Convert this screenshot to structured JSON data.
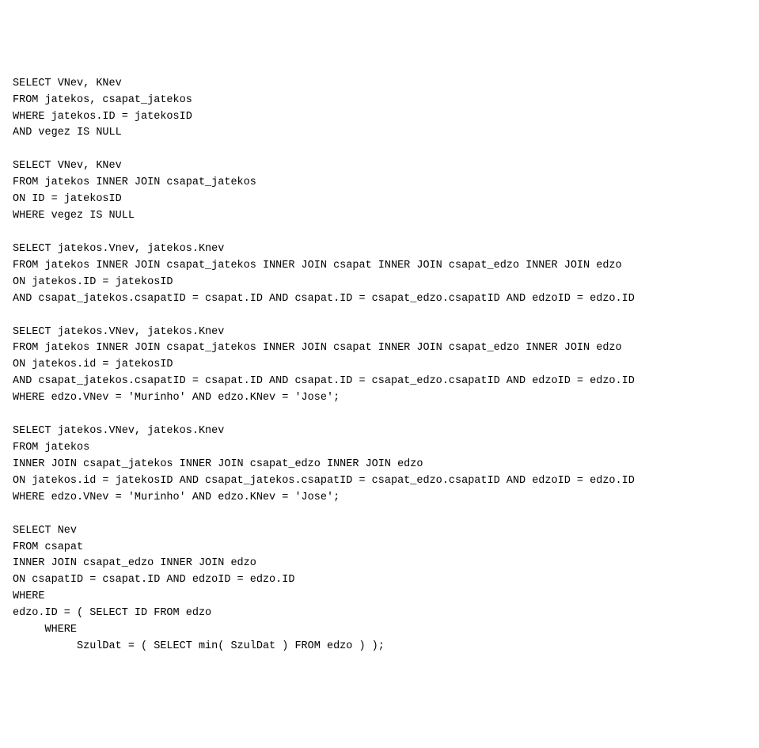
{
  "content": {
    "lines": [
      "SELECT VNev, KNev",
      "FROM jatekos, csapat_jatekos",
      "WHERE jatekos.ID = jatekosID",
      "AND vegez IS NULL",
      "",
      "SELECT VNev, KNev",
      "FROM jatekos INNER JOIN csapat_jatekos",
      "ON ID = jatekosID",
      "WHERE vegez IS NULL",
      "",
      "SELECT jatekos.Vnev, jatekos.Knev",
      "FROM jatekos INNER JOIN csapat_jatekos INNER JOIN csapat INNER JOIN csapat_edzo INNER JOIN edzo",
      "ON jatekos.ID = jatekosID",
      "AND csapat_jatekos.csapatID = csapat.ID AND csapat.ID = csapat_edzo.csapatID AND edzoID = edzo.ID",
      "",
      "SELECT jatekos.VNev, jatekos.Knev",
      "FROM jatekos INNER JOIN csapat_jatekos INNER JOIN csapat INNER JOIN csapat_edzo INNER JOIN edzo",
      "ON jatekos.id = jatekosID",
      "AND csapat_jatekos.csapatID = csapat.ID AND csapat.ID = csapat_edzo.csapatID AND edzoID = edzo.ID",
      "WHERE edzo.VNev = 'Murinho' AND edzo.KNev = 'Jose';",
      "",
      "SELECT jatekos.VNev, jatekos.Knev",
      "FROM jatekos",
      "INNER JOIN csapat_jatekos INNER JOIN csapat_edzo INNER JOIN edzo",
      "ON jatekos.id = jatekosID AND csapat_jatekos.csapatID = csapat_edzo.csapatID AND edzoID = edzo.ID",
      "WHERE edzo.VNev = 'Murinho' AND edzo.KNev = 'Jose';",
      "",
      "SELECT Nev",
      "FROM csapat",
      "INNER JOIN csapat_edzo INNER JOIN edzo",
      "ON csapatID = csapat.ID AND edzoID = edzo.ID",
      "WHERE",
      "edzo.ID = ( SELECT ID FROM edzo",
      "     WHERE",
      "          SzulDat = ( SELECT min( SzulDat ) FROM edzo ) );"
    ]
  }
}
